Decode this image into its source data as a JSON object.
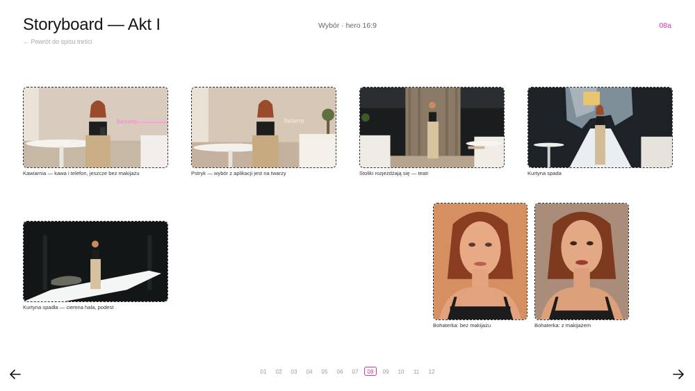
{
  "header": {
    "title": "Storyboard — Akt I",
    "back_link": "← Powrót do spisu treści",
    "subtitle": "Wybór · hero 16:9",
    "slide_code": "08a"
  },
  "frames": [
    {
      "caption": "Kawiarnia — kawa i telefon, jeszcze bez makijażu",
      "neon": "besem"
    },
    {
      "caption": "Pstryk — wybór z aplikacji jest na twarzy",
      "neon": "besem"
    },
    {
      "caption": "Stoliki rozjeżdżają się — teatr"
    },
    {
      "caption": "Kurtyna spada"
    },
    {
      "caption": "Kurtyna spadła — ciemna hala, podest"
    },
    {
      "caption": "Bohaterka: bez makijażu"
    },
    {
      "caption": "Bohaterka: z makijażem"
    }
  ],
  "pager": {
    "pages": [
      "01",
      "02",
      "03",
      "04",
      "05",
      "06",
      "07",
      "08",
      "09",
      "10",
      "11",
      "12"
    ],
    "active": "08"
  },
  "nav": {
    "prev_icon": "arrow-left-icon",
    "next_icon": "arrow-right-icon"
  },
  "colors": {
    "accent": "#d42fb8",
    "neon": "#ff7fd8"
  }
}
